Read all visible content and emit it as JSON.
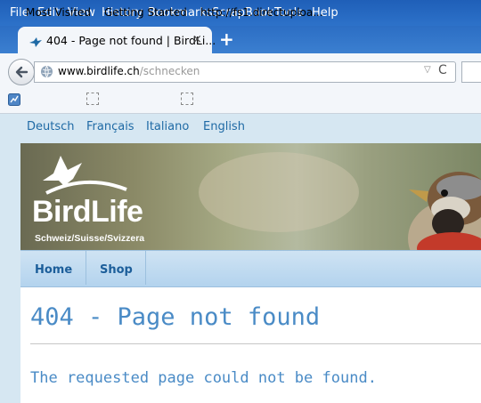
{
  "browser": {
    "menu": [
      "File",
      "Edit",
      "View",
      "History",
      "Bookmarks",
      "ScrapBook",
      "Tools",
      "Help"
    ],
    "tab_title": "404 - Page not found | BirdLi...",
    "tab_close": "×",
    "new_tab": "+",
    "url_domain": "www.birdlife.ch",
    "url_path": "/schnecken",
    "url_dropdown": "▽",
    "reload": "C",
    "bookmarks": [
      "Most Visited",
      "Getting Started",
      "http://fs1.directuploa..."
    ]
  },
  "site": {
    "languages": [
      "Deutsch",
      "Français",
      "Italiano",
      "English"
    ],
    "logo_name": "BirdLife",
    "logo_subtitle": "Schweiz/Suisse/Svizzera",
    "nav": [
      "Home",
      "Shop"
    ],
    "heading": "404 - Page not found",
    "message": "The requested page could not be found."
  },
  "colors": {
    "browser_chrome": "#2d72c9",
    "page_background": "#d6e7f2",
    "link": "#1f6aa5",
    "heading": "#4a8bc6"
  }
}
